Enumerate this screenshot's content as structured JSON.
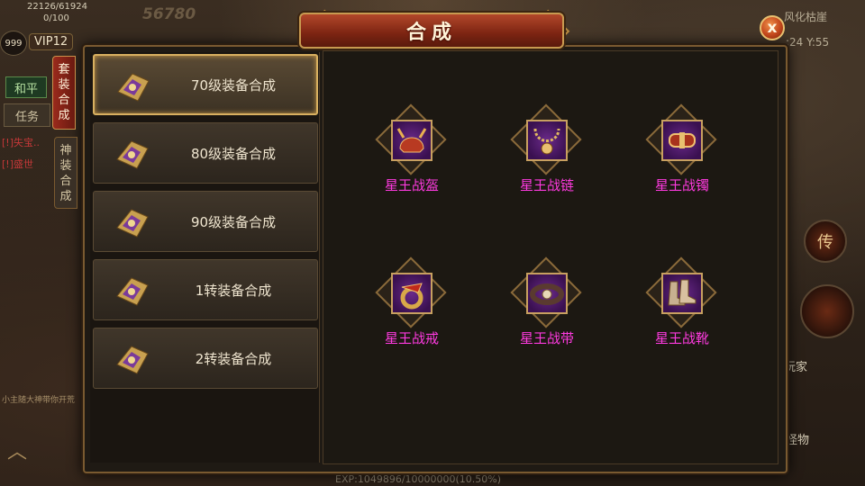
{
  "hud": {
    "hp_text": "22126/61924",
    "mp_text": "0/100",
    "power": "56780",
    "level": "999",
    "vip": "VIP12",
    "mode": "和平",
    "task_button": "任务",
    "sys_messages": [
      "[!]失宝..",
      "[!]盛世"
    ],
    "chat_line": "小主随大神带你开荒",
    "map_name": "风化枯崖",
    "coords": ":24 Y:55",
    "exp_text": "EXP:1049896/10000000(10.50%)",
    "player_label": "玩家",
    "monster_label": "怪物",
    "chuan_label": "传"
  },
  "dialog": {
    "title": "合成",
    "close_label": "x",
    "tabs": [
      {
        "label": [
          "套",
          "装",
          "合",
          "成"
        ],
        "active": true
      },
      {
        "label": [
          "神",
          "装",
          "合",
          "成"
        ],
        "active": false
      }
    ],
    "list": [
      {
        "label": "70级装备合成",
        "selected": true
      },
      {
        "label": "80级装备合成",
        "selected": false
      },
      {
        "label": "90级装备合成",
        "selected": false
      },
      {
        "label": "1转装备合成",
        "selected": false
      },
      {
        "label": "2转装备合成",
        "selected": false
      }
    ],
    "items": [
      {
        "name": "星王战盔",
        "icon": "helmet-icon"
      },
      {
        "name": "星王战链",
        "icon": "necklace-icon"
      },
      {
        "name": "星王战镯",
        "icon": "bracelet-icon"
      },
      {
        "name": "星王战戒",
        "icon": "ring-icon"
      },
      {
        "name": "星王战带",
        "icon": "belt-icon"
      },
      {
        "name": "星王战靴",
        "icon": "boots-icon"
      }
    ]
  },
  "colors": {
    "item_name": "#ff3ae0",
    "title_bg": "#7c2412",
    "selected_border": "#d8b060"
  }
}
